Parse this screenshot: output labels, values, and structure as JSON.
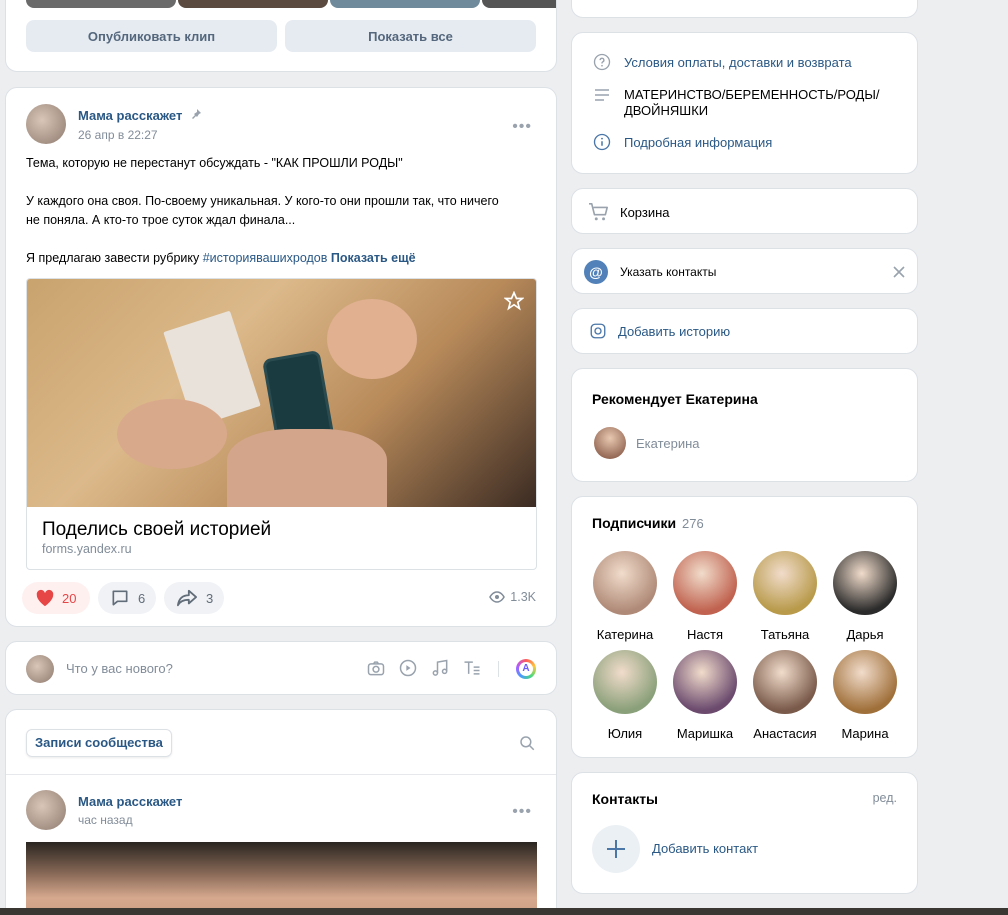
{
  "top_clips_card": {
    "publish_clip": "Опубликовать клип",
    "show_all": "Показать все"
  },
  "post1": {
    "author": "Мама расскажет",
    "date": "26 апр в 22:27",
    "line1": "Тема, которую не перестанут обсуждать - \"КАК ПРОШЛИ РОДЫ\"",
    "line2a": "У каждого она своя. По-своему уникальная. У кого-то они прошли так, что ничего",
    "line2b": "не поняла. А кто-то трое суток ждал финала...",
    "line3": "Я предлагаю завести рубрику",
    "hashtag": "#историявашихродов",
    "show_more": "Показать ещё",
    "link_title": "Поделись своей историей",
    "link_domain": "forms.yandex.ru",
    "likes": "20",
    "comments": "6",
    "shares": "3",
    "views": "1.3K"
  },
  "composer": {
    "placeholder": "Что у вас нового?"
  },
  "feed": {
    "tab_label": "Записи сообщества"
  },
  "post2": {
    "author": "Мама расскажет",
    "date": "час назад"
  },
  "info": {
    "terms": "Условия оплаты, доставки и возврата",
    "category_line1": "МАТЕРИНСТВО/БЕРЕМЕННОСТЬ/РОДЫ/",
    "category_line2": "ДВОЙНЯШКИ",
    "more_info": "Подробная информация"
  },
  "cart": {
    "label": "Корзина"
  },
  "contacts_hint": {
    "label": "Указать контакты"
  },
  "story": {
    "label": "Добавить историю"
  },
  "recommends": {
    "title": "Рекомендует Екатерина",
    "name": "Екатерина"
  },
  "subscribers": {
    "title": "Подписчики",
    "count": "276",
    "people": [
      {
        "name": "Катерина",
        "color": "#b08a78"
      },
      {
        "name": "Настя",
        "color": "#c0624f"
      },
      {
        "name": "Татьяна",
        "color": "#b89a4a"
      },
      {
        "name": "Дарья",
        "color": "#2b2b2b"
      },
      {
        "name": "Юлия",
        "color": "#8aa07a"
      },
      {
        "name": "Маришка",
        "color": "#6b4a6e"
      },
      {
        "name": "Анастасия",
        "color": "#7a5a4a"
      },
      {
        "name": "Марина",
        "color": "#a0703a"
      }
    ]
  },
  "contacts": {
    "title": "Контакты",
    "edit": "ред.",
    "add": "Добавить контакт"
  },
  "colors": {
    "accent": "#2a5885",
    "like_red": "#e64646",
    "page_bg": "#edeef0"
  }
}
